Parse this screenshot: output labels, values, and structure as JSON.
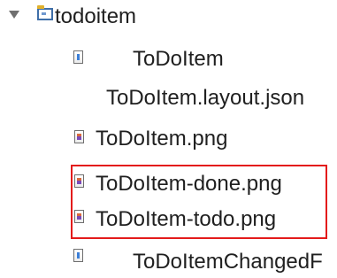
{
  "tree": {
    "folder": {
      "label": "todoitem",
      "expand_icon": "chevron-down-icon",
      "icon": "folder-icon"
    },
    "items": [
      {
        "label": "ToDoItem",
        "icon": "code-file-icon"
      },
      {
        "label": "ToDoItem.layout.json",
        "icon": ""
      },
      {
        "label": "ToDoItem.png",
        "icon": "image-file-icon"
      },
      {
        "label": "ToDoItem-done.png",
        "icon": "image-file-icon"
      },
      {
        "label": "ToDoItem-todo.png",
        "icon": "image-file-icon"
      },
      {
        "label": "ToDoItemChangedF",
        "icon": "code-file-icon"
      }
    ]
  },
  "highlight": {
    "color": "#e31b1b"
  }
}
